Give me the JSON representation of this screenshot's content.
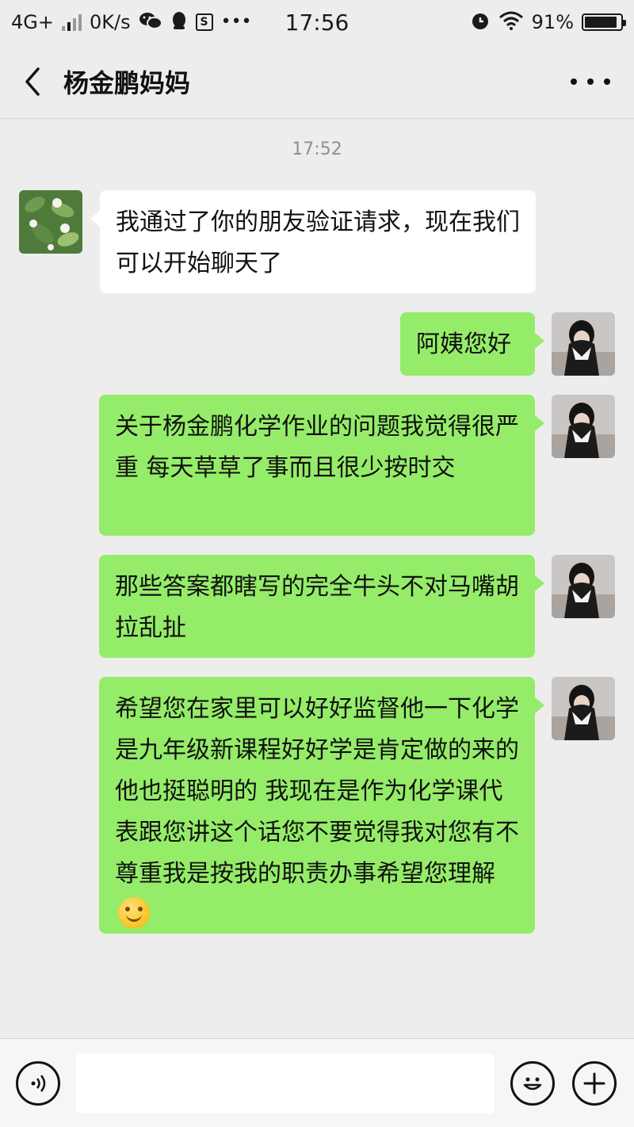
{
  "status_bar": {
    "network": "4G+",
    "speed": "0K/s",
    "time": "17:56",
    "battery_percent": "91%",
    "battery_level": 0.91,
    "left_icons": [
      "signal-icon",
      "wechat-icon",
      "qq-penguin-icon",
      "s-app-icon",
      "more-notifications-icon"
    ],
    "right_icons": [
      "alarm-icon",
      "wifi-icon",
      "battery-icon"
    ]
  },
  "header": {
    "title": "杨金鹏妈妈",
    "back_icon": "back-arrow-icon",
    "more_icon": "more-dots-icon"
  },
  "chat": {
    "timestamp": "17:52",
    "messages": [
      {
        "side": "left",
        "avatar": "leaves-avatar",
        "text": "我通过了你的朋友验证请求，现在我们可以开始聊天了"
      },
      {
        "side": "right",
        "avatar": "girl-avatar",
        "text": "阿姨您好"
      },
      {
        "side": "right",
        "avatar": "girl-avatar",
        "text": "关于杨金鹏化学作业的问题我觉得很严重  每天草草了事而且很少按时交"
      },
      {
        "side": "right",
        "avatar": "girl-avatar",
        "text": "那些答案都瞎写的完全牛头不对马嘴胡拉乱扯"
      },
      {
        "side": "right",
        "avatar": "girl-avatar",
        "text": "希望您在家里可以好好监督他一下化学是九年级新课程好好学是肯定做的来的他也挺聪明的 我现在是作为化学课代表跟您讲这个话您不要觉得我对您有不尊重我是按我的职责办事希望您理解",
        "emoji": "smile-emoji"
      }
    ]
  },
  "input_bar": {
    "placeholder": "",
    "voice_icon": "voice-icon",
    "emoji_icon": "emoji-icon",
    "plus_icon": "plus-icon"
  },
  "colors": {
    "background": "#ededed",
    "sent_bubble": "#95ec69",
    "received_bubble": "#ffffff",
    "timestamp": "#8f8f8f"
  }
}
